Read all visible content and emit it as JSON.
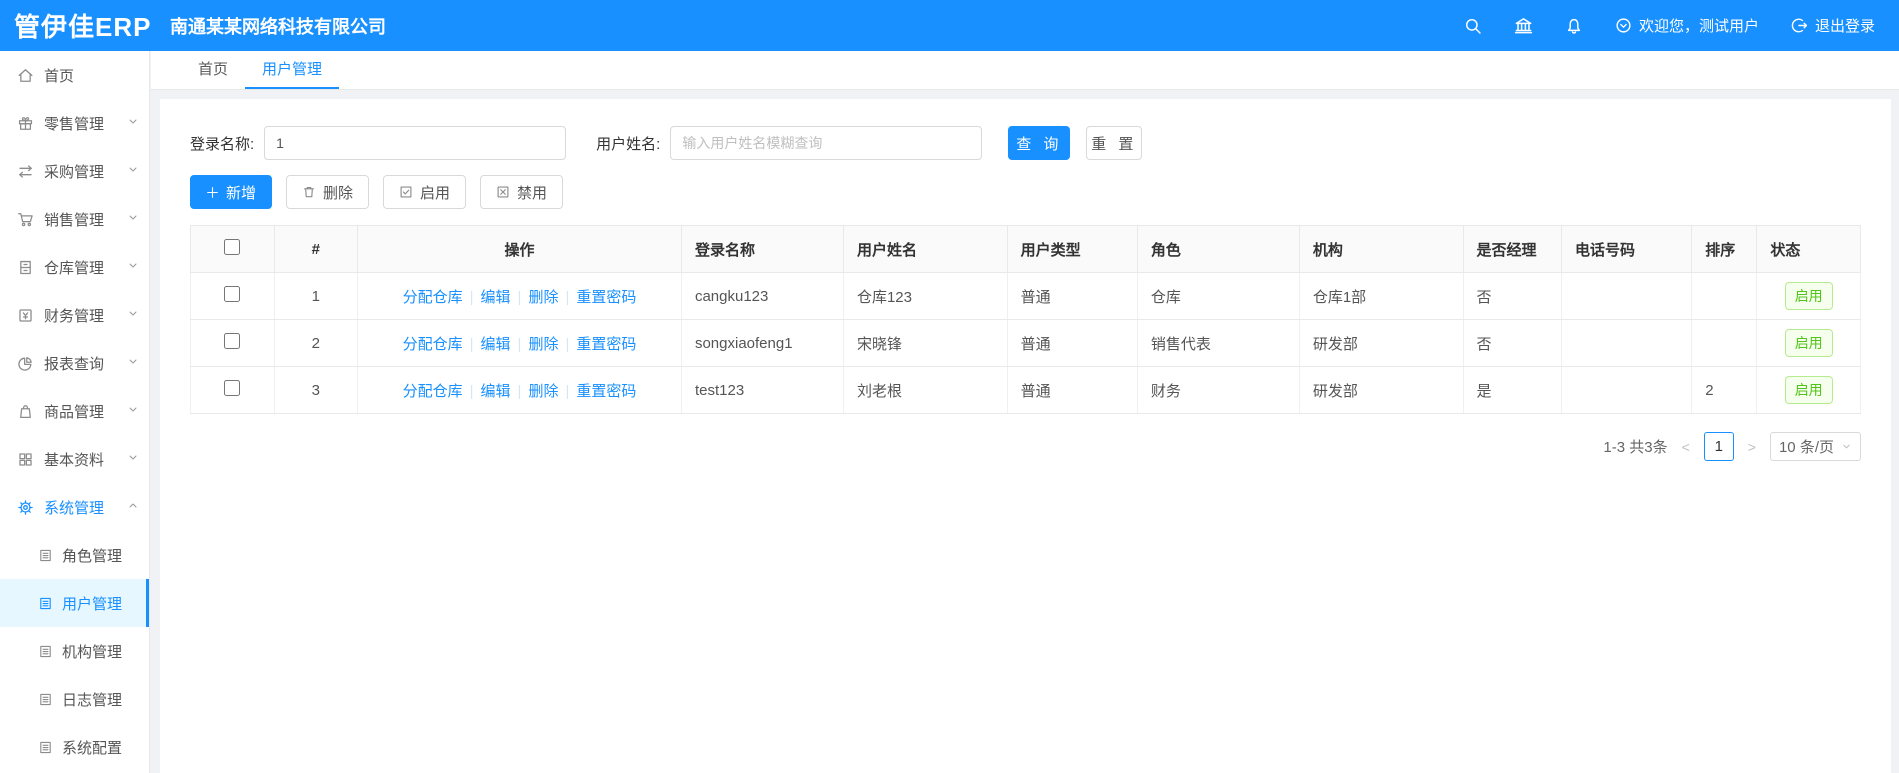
{
  "app": {
    "logo": "管伊佳ERP",
    "company": "南通某某网络科技有限公司"
  },
  "header": {
    "welcome": "欢迎您，测试用户",
    "logout": "退出登录"
  },
  "sidebar": {
    "items": [
      {
        "label": "首页"
      },
      {
        "label": "零售管理"
      },
      {
        "label": "采购管理"
      },
      {
        "label": "销售管理"
      },
      {
        "label": "仓库管理"
      },
      {
        "label": "财务管理"
      },
      {
        "label": "报表查询"
      },
      {
        "label": "商品管理"
      },
      {
        "label": "基本资料"
      },
      {
        "label": "系统管理"
      }
    ],
    "sub_items": [
      {
        "label": "角色管理"
      },
      {
        "label": "用户管理"
      },
      {
        "label": "机构管理"
      },
      {
        "label": "日志管理"
      },
      {
        "label": "系统配置"
      }
    ]
  },
  "tabs": {
    "home": "首页",
    "current": "用户管理"
  },
  "search": {
    "login_label": "登录名称:",
    "login_value": "1",
    "name_label": "用户姓名:",
    "name_placeholder": "输入用户姓名模糊查询",
    "query_label": "查 询",
    "reset_label": "重 置"
  },
  "toolbar": {
    "add": "新增",
    "delete": "删除",
    "enable": "启用",
    "disable": "禁用"
  },
  "table": {
    "headers": {
      "index": "#",
      "actions": "操作",
      "login": "登录名称",
      "name": "用户姓名",
      "type": "用户类型",
      "role": "角色",
      "org": "机构",
      "manager": "是否经理",
      "phone": "电话号码",
      "sort": "排序",
      "status": "状态"
    },
    "row_actions": [
      "分配仓库",
      "编辑",
      "删除",
      "重置密码"
    ],
    "rows": [
      {
        "index": "1",
        "login": "cangku123",
        "name": "仓库123",
        "type": "普通",
        "role": "仓库",
        "org": "仓库1部",
        "manager": "否",
        "phone": "",
        "sort": "",
        "status": "启用"
      },
      {
        "index": "2",
        "login": "songxiaofeng1",
        "name": "宋晓锋",
        "type": "普通",
        "role": "销售代表",
        "org": "研发部",
        "manager": "否",
        "phone": "",
        "sort": "",
        "status": "启用"
      },
      {
        "index": "3",
        "login": "test123",
        "name": "刘老根",
        "type": "普通",
        "role": "财务",
        "org": "研发部",
        "manager": "是",
        "phone": "",
        "sort": "2",
        "status": "启用"
      }
    ]
  },
  "pagination": {
    "total": "1-3 共3条",
    "prev": "<",
    "page": "1",
    "next": ">",
    "page_size": "10 条/页"
  },
  "colors": {
    "primary": "#1890ff",
    "success": "#52c41a",
    "success_border": "#b7eb8f",
    "success_bg": "#f6ffed"
  }
}
